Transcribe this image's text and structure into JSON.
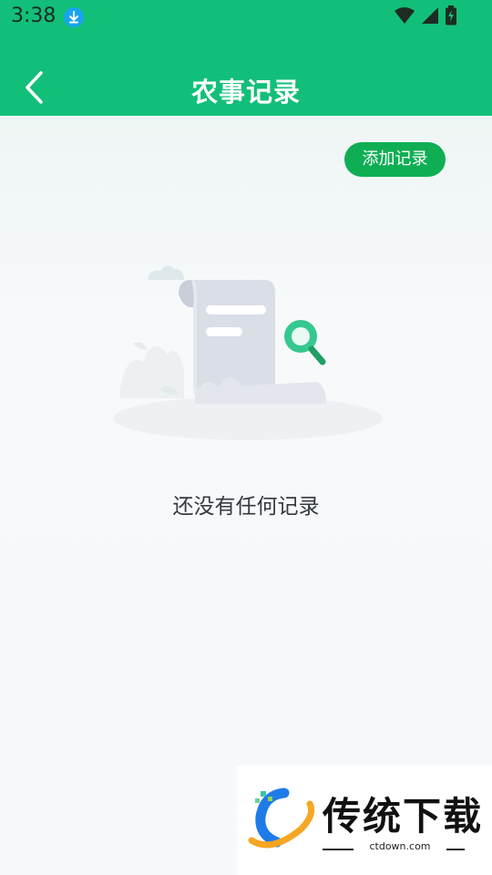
{
  "status_bar": {
    "time": "3:38",
    "icons": [
      "download-icon",
      "wifi-icon",
      "signal-icon",
      "battery-charging-icon"
    ]
  },
  "app_bar": {
    "back_icon": "chevron-left-icon",
    "title": "农事记录"
  },
  "main": {
    "add_button_label": "添加记录",
    "empty_illustration": "document-magnifier-illustration",
    "empty_message": "还没有任何记录"
  },
  "watermark": {
    "name": "传统下载",
    "url": "ctdown.com"
  },
  "colors": {
    "primary_green": "#12bf78",
    "button_green": "#0fae55",
    "background": "#f6f8fb"
  }
}
